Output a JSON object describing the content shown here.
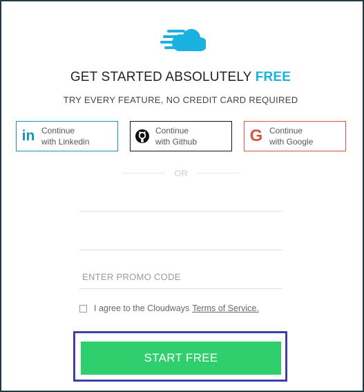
{
  "brand": {
    "logo_icon": "cloud-speed-icon",
    "accent_color": "#1ab0e0"
  },
  "header": {
    "title_main": "GET STARTED ABSOLUTELY",
    "title_accent": "FREE",
    "subtitle": "TRY EVERY FEATURE, NO CREDIT CARD REQUIRED"
  },
  "social": {
    "linkedin": {
      "line1": "Continue",
      "line2": "with Linkedin",
      "icon": "linkedin-icon",
      "color": "#1a8fc1"
    },
    "github": {
      "line1": "Continue",
      "line2": "with Github",
      "icon": "github-icon",
      "color": "#111111"
    },
    "google": {
      "line1": "Continue",
      "line2": "with Google",
      "icon": "google-icon",
      "color": "#d6533f"
    }
  },
  "divider": {
    "label": "OR"
  },
  "form": {
    "field1_placeholder": "",
    "field2_placeholder": "",
    "promo_placeholder": "ENTER PROMO CODE",
    "agree_text": "I agree to the Cloudways",
    "terms_link": "Terms of Service."
  },
  "cta": {
    "label": "START FREE",
    "color": "#2fcf6e",
    "highlight_color": "#3f3fa8"
  }
}
